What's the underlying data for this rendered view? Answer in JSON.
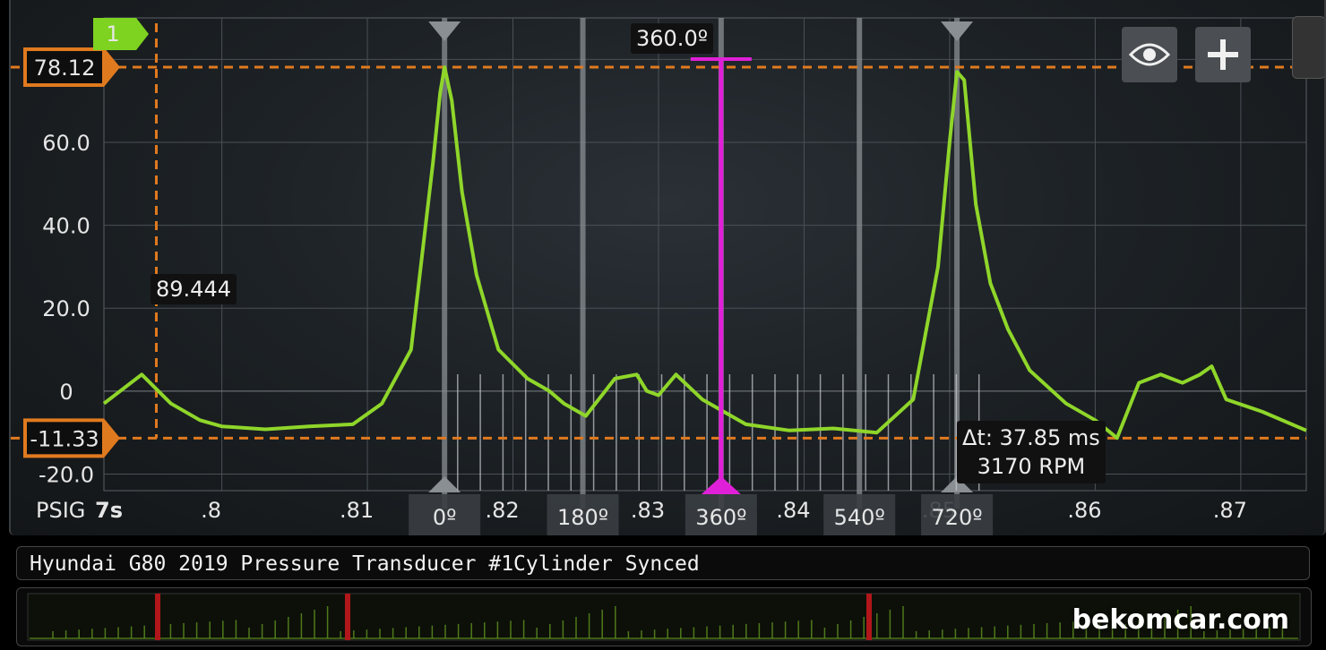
{
  "channel_badge": "1",
  "y_axis": {
    "ticks": [
      "80.0",
      "60.0",
      "40.0",
      "20.0",
      "0",
      "-20.0"
    ],
    "unit": "PSIG"
  },
  "x_axis": {
    "start_label": "7s",
    "ticks": [
      ".8",
      ".81",
      ".82",
      ".83",
      ".84",
      ".85",
      ".86",
      ".87"
    ]
  },
  "cursors": {
    "upper_value": "78.12",
    "lower_value": "-11.33",
    "vertical_value": "89.444"
  },
  "degree_markers": [
    "0º",
    "180º",
    "360º",
    "540º",
    "720º"
  ],
  "magenta_marker_label": "360.0º",
  "measurement": {
    "delta_t": "Δt: 37.85 ms",
    "rpm": "3170 RPM"
  },
  "title_bar": "Hyundai G80 2019 Pressure Transducer #1Cylinder Synced",
  "watermark": "bekomcar.com",
  "colors": {
    "trace": "#8fd62a",
    "cursor": "#e07a1f",
    "magenta": "#e020d8",
    "badge": "#7ed321"
  },
  "icons": [
    "eye-icon",
    "plus-icon"
  ],
  "chart_data": {
    "type": "line",
    "series": [
      {
        "x": [
          0.7919,
          0.7945,
          0.7965,
          0.7985,
          0.8,
          0.803,
          0.806,
          0.809,
          0.811,
          0.813,
          0.8135,
          0.8145,
          0.815,
          0.8153,
          0.8158,
          0.8165,
          0.8175,
          0.819,
          0.821,
          0.8225,
          0.8235,
          0.825,
          0.827,
          0.8285,
          0.8292,
          0.83,
          0.8312,
          0.833,
          0.836,
          0.839,
          0.842,
          0.845,
          0.8475,
          0.8492,
          0.85,
          0.8505,
          0.851,
          0.8518,
          0.8528,
          0.854,
          0.8555,
          0.858,
          0.86,
          0.8615,
          0.863,
          0.8645,
          0.866,
          0.8672,
          0.868,
          0.869,
          0.8715,
          0.8745
        ],
        "y": [
          -3,
          4,
          -3,
          -7,
          -8.5,
          -9.2,
          -8.5,
          -8,
          -3,
          10,
          25,
          55,
          72,
          78.1,
          70,
          48,
          28,
          10,
          3,
          0,
          -3,
          -6,
          3,
          4,
          0,
          -1,
          4,
          -2,
          -8,
          -9.5,
          -9,
          -10,
          -2,
          30,
          60,
          77,
          75,
          45,
          26,
          15,
          5,
          -3,
          -7,
          -11.3,
          2,
          4,
          2,
          4,
          6,
          -2,
          -5,
          -9.5
        ]
      }
    ],
    "xlim": [
      0.7919,
      0.8745
    ],
    "ylim": [
      -24,
      90
    ]
  }
}
